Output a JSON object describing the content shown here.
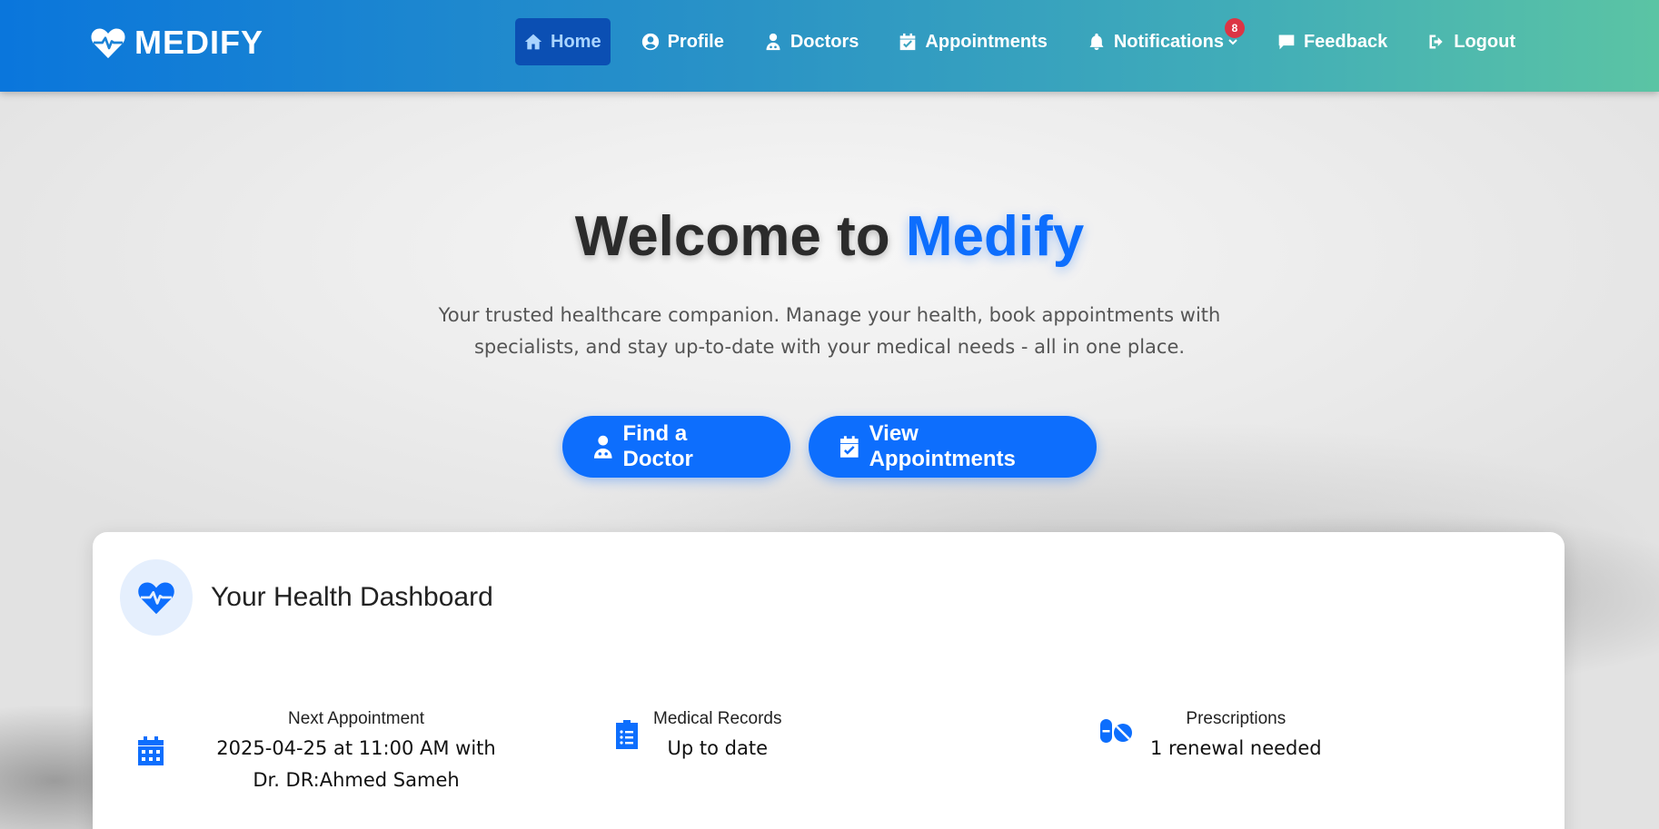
{
  "brand": {
    "name": "MEDIFY",
    "icon": "heart-pulse-icon"
  },
  "nav": {
    "items": [
      {
        "label": "Home",
        "icon": "home-icon",
        "active": true
      },
      {
        "label": "Profile",
        "icon": "user-circle-icon"
      },
      {
        "label": "Doctors",
        "icon": "doctor-icon"
      },
      {
        "label": "Appointments",
        "icon": "calendar-check-icon"
      },
      {
        "label": "Notifications",
        "icon": "bell-icon",
        "badge": "8"
      },
      {
        "label": "Feedback",
        "icon": "comment-icon"
      },
      {
        "label": "Logout",
        "icon": "sign-out-icon"
      }
    ]
  },
  "hero": {
    "title_prefix": "Welcome to",
    "title_accent": "Medify",
    "subtitle": "Your trusted healthcare companion. Manage your health, book appointments with specialists, and stay up-to-date with your medical needs - all in one place.",
    "buttons": {
      "find_doctor": "Find a Doctor",
      "view_appointments": "View Appointments"
    }
  },
  "dashboard": {
    "title": "Your Health Dashboard",
    "stats": [
      {
        "label": "Next Appointment",
        "value": "2025-04-25 at 11:00 AM with Dr. DR:Ahmed Sameh",
        "icon": "calendar-icon"
      },
      {
        "label": "Medical Records",
        "value": "Up to date",
        "icon": "clipboard-list-icon"
      },
      {
        "label": "Prescriptions",
        "value": "1 renewal needed",
        "icon": "pills-icon"
      }
    ]
  },
  "colors": {
    "primary": "#0d6efd",
    "nav_active": "#0b4fb3",
    "badge": "#dc3545"
  }
}
